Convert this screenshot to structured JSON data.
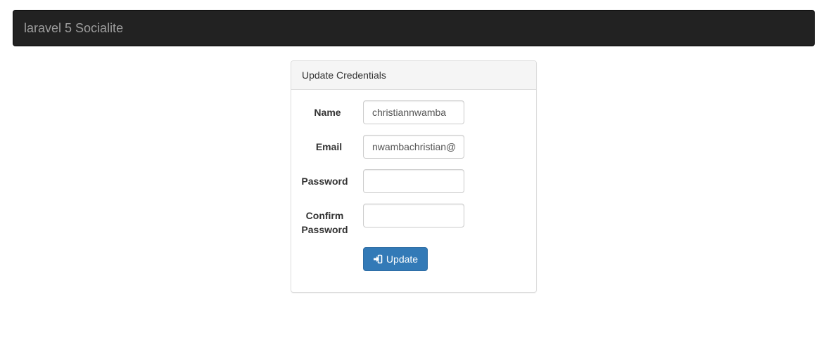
{
  "navbar": {
    "brand": "laravel 5 Socialite"
  },
  "panel": {
    "heading": "Update Credentials"
  },
  "form": {
    "name": {
      "label": "Name",
      "value": "christiannwamba"
    },
    "email": {
      "label": "Email",
      "value": "nwambachristian@"
    },
    "password": {
      "label": "Password",
      "value": ""
    },
    "confirm_password": {
      "label_line1": "Confirm",
      "label_line2": "Password",
      "value": ""
    },
    "submit": {
      "label": "Update",
      "icon": "sign-in-icon"
    }
  },
  "colors": {
    "navbar_bg": "#222222",
    "brand_text": "#9d9d9d",
    "primary": "#337ab7",
    "panel_heading_bg": "#f5f5f5",
    "border": "#dddddd"
  }
}
